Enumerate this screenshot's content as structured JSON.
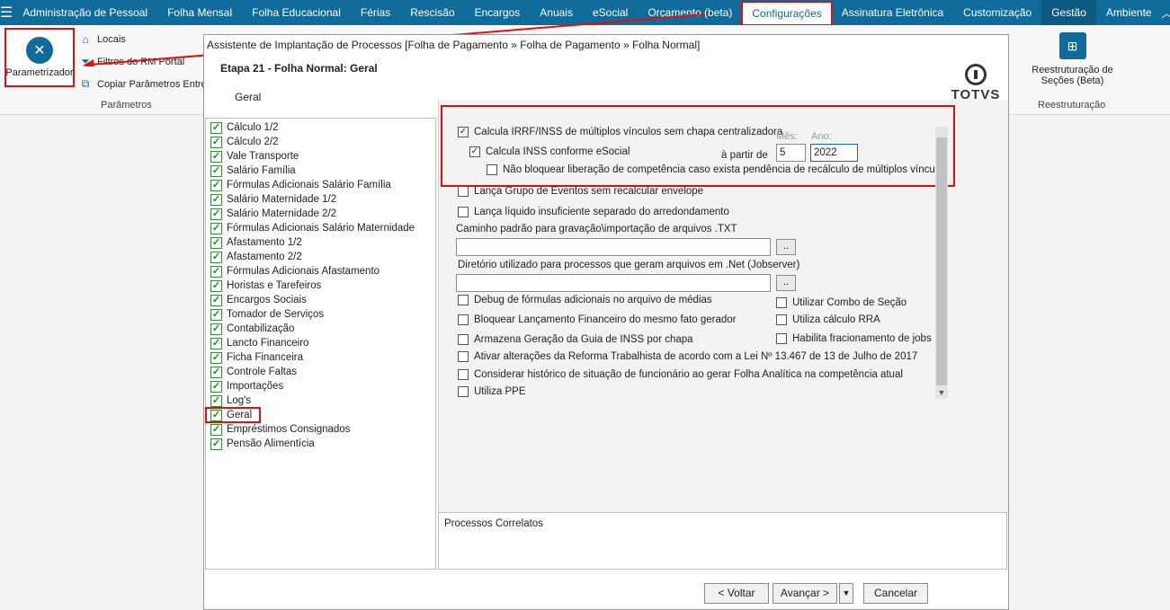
{
  "menubar": {
    "items": [
      "Administração de Pessoal",
      "Folha Mensal",
      "Folha Educacional",
      "Férias",
      "Rescisão",
      "Encargos",
      "Anuais",
      "eSocial",
      "Orçamento (beta)",
      "Configurações",
      "Assinatura Eletrônica",
      "Customização",
      "Gestão",
      "Ambiente"
    ],
    "active": "Configurações"
  },
  "ribbon": {
    "param_label": "Parametrizador",
    "items": [
      "Locais",
      "Filtros do RM Portal",
      "Copiar Parâmetros Entre"
    ],
    "group_label": "Parâmetros",
    "restr_label": "Reestruturação de Seções (Beta)",
    "restr_group": "Reestruturação"
  },
  "dialog": {
    "title": "Assistente de Implantação de Processos [Folha de Pagamento » Folha de Pagamento » Folha Normal]",
    "stage": "Etapa 21 - Folha Normal: Geral",
    "sub": "Geral",
    "logo": "TOTVS"
  },
  "tree": [
    "Cálculo 1/2",
    "Cálculo 2/2",
    "Vale Transporte",
    "Salário Família",
    "Fórmulas Adicionais Salário Família",
    "Salário Maternidade 1/2",
    "Salário Maternidade 2/2",
    "Fórmulas Adicionais Salário Maternidade",
    "Afastamento 1/2",
    "Afastamento 2/2",
    "Fórmulas Adicionais Afastamento",
    "Horistas e Tarefeiros",
    "Encargos Sociais",
    "Tomador de Serviços",
    "Contabilização",
    "Lancto Financeiro",
    "Ficha Financeira",
    "Controle Faltas",
    "Importações",
    "Log's",
    "Geral",
    "Empréstimos Consignados",
    "Pensão Alimentícia"
  ],
  "panel": {
    "cb_irrf": "Calcula IRRF/INSS de múltiplos vínculos sem chapa centralizadora",
    "cb_inss": "Calcula INSS conforme eSocial",
    "a_partir": "à partir de",
    "mes_label": "Mês:",
    "ano_label": "Ano:",
    "mes_value": "5",
    "ano_value": "2022",
    "cb_nao_bloq": "Não bloquear liberação de competência caso exista pendência de recálculo de múltiplos vínculos",
    "cb_lanca_grupo": "Lança Grupo de Eventos sem recalcular envelope",
    "cb_lanca_liq": "Lança líquido insuficiente separado do arredondamento",
    "caminho_label": "Caminho padrão para gravação\\importação de arquivos .TXT",
    "diretorio_label": "Diretório utilizado para processos que geram arquivos em .Net (Jobserver)",
    "dots": "..",
    "cb_debug": "Debug de fórmulas adicionais no arquivo de médias",
    "cb_bloquear": "Bloquear Lançamento Financeiro do mesmo fato gerador",
    "cb_armazena": "Armazena Geração da Guia de INSS por chapa",
    "cb_ativar": "Ativar alterações da Reforma Trabalhista de acordo com a Lei Nº 13.467 de 13 de Julho de 2017",
    "cb_considerar": "Considerar histórico de situação de funcionário ao gerar Folha Analítica na competência atual",
    "cb_ppe": "Utiliza PPE",
    "cb_combo": "Utilizar Combo de Seção",
    "cb_rra": "Utiliza cálculo RRA",
    "cb_jobs": "Habilita fracionamento de jobs",
    "correlatos": "Processos Correlatos"
  },
  "footer": {
    "voltar": "< Voltar",
    "avancar": "Avançar >",
    "cancelar": "Cancelar"
  },
  "colors": {
    "accent": "#0f6b99",
    "highlight": "#e01010",
    "check": "#1c8c1c"
  }
}
